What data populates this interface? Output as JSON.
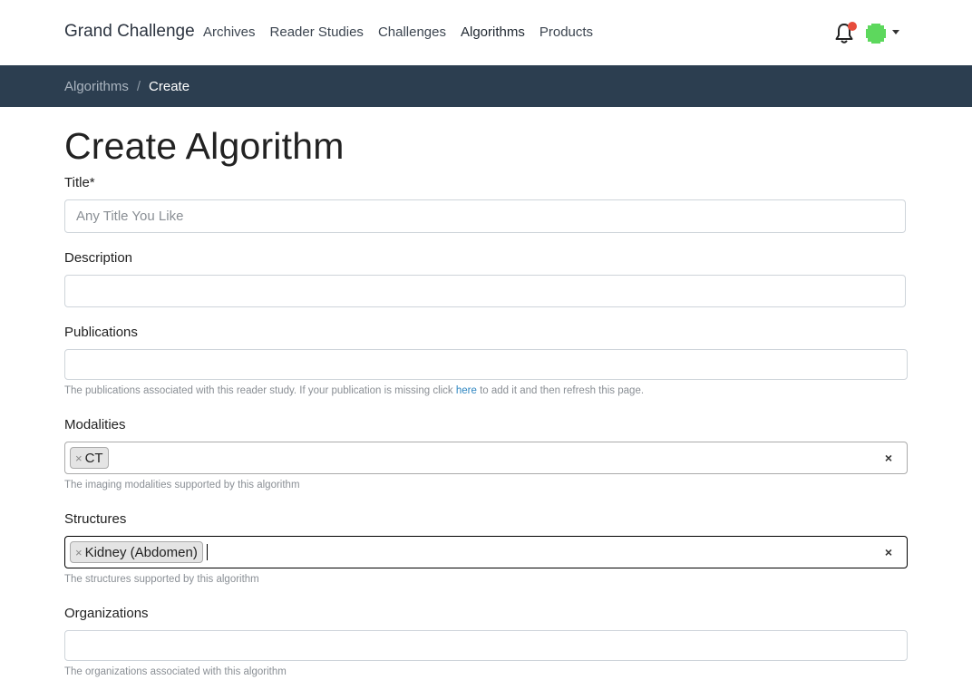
{
  "navbar": {
    "brand": "Grand Challenge",
    "links": [
      "Archives",
      "Reader Studies",
      "Challenges",
      "Algorithms",
      "Products"
    ],
    "active_link": "Algorithms",
    "notification_indicator_color": "#e74c3c",
    "icons": [
      "bell-icon",
      "avatar-icon",
      "caret-down-icon"
    ]
  },
  "breadcrumb": {
    "items": [
      "Algorithms",
      "Create"
    ],
    "separator": "/"
  },
  "page": {
    "title": "Create Algorithm"
  },
  "form": {
    "title": {
      "label": "Title*",
      "placeholder": "Any Title You Like",
      "value": ""
    },
    "description": {
      "label": "Description",
      "value": ""
    },
    "publications": {
      "label": "Publications",
      "value": "",
      "help_before": "The publications associated with this reader study. If your publication is missing click ",
      "help_link": "here",
      "help_after": " to add it and then refresh this page."
    },
    "modalities": {
      "label": "Modalities",
      "selected": [
        "CT"
      ],
      "remove_glyph": "×",
      "clear_glyph": "×",
      "help": "The imaging modalities supported by this algorithm"
    },
    "structures": {
      "label": "Structures",
      "selected": [
        "Kidney (Abdomen)"
      ],
      "remove_glyph": "×",
      "clear_glyph": "×",
      "help": "The structures supported by this algorithm"
    },
    "organizations": {
      "label": "Organizations",
      "value": "",
      "help": "The organizations associated with this algorithm"
    }
  },
  "colors": {
    "breadcrumb_bar": "#2c3e50",
    "link": "#2e86c1",
    "avatar": "#5dd85d"
  }
}
